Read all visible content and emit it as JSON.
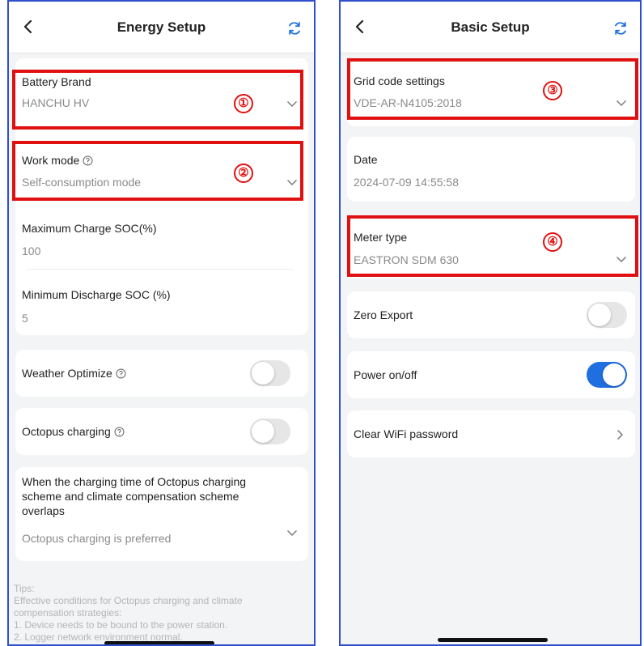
{
  "left": {
    "title": "Energy Setup",
    "battery_brand": {
      "label": "Battery Brand",
      "value": "HANCHU HV",
      "marker": "①"
    },
    "work_mode": {
      "label": "Work mode",
      "value": "Self-consumption mode",
      "marker": "②"
    },
    "max_charge": {
      "label": "Maximum Charge SOC(%)",
      "value": "100"
    },
    "min_discharge": {
      "label": "Minimum Discharge SOC (%)",
      "value": "5"
    },
    "weather_optimize": {
      "label": "Weather Optimize",
      "enabled": false
    },
    "octopus_charging": {
      "label": "Octopus charging",
      "enabled": false
    },
    "overlap": {
      "label_lines": [
        "When the charging time of Octopus charging",
        "scheme and climate compensation scheme",
        "overlaps"
      ],
      "value": "Octopus charging is preferred"
    },
    "tips": [
      "Tips:",
      "Effective conditions for Octopus charging and climate",
      "compensation strategies:",
      "1. Device needs to be bound to the power station.",
      "2. Logger network environment normal."
    ]
  },
  "right": {
    "title": "Basic Setup",
    "grid_code": {
      "label": "Grid code settings",
      "value": "VDE-AR-N4105:2018",
      "marker": "③"
    },
    "date": {
      "label": "Date",
      "value": "2024-07-09 14:55:58"
    },
    "meter_type": {
      "label": "Meter type",
      "value": "EASTRON SDM 630",
      "marker": "④"
    },
    "zero_export": {
      "label": "Zero Export",
      "enabled": false
    },
    "power": {
      "label": "Power on/off",
      "enabled": true
    },
    "clear_wifi": {
      "label": "Clear WiFi password"
    }
  },
  "colors": {
    "highlight": "#e01010",
    "toggle_on": "#1f6fe0",
    "frame": "#2f4fcf",
    "refresh_icon": "#1f6fe0"
  },
  "icons": [
    "back-icon",
    "refresh-icon",
    "chevron-down-icon",
    "chevron-right-icon",
    "help-circle-icon"
  ]
}
